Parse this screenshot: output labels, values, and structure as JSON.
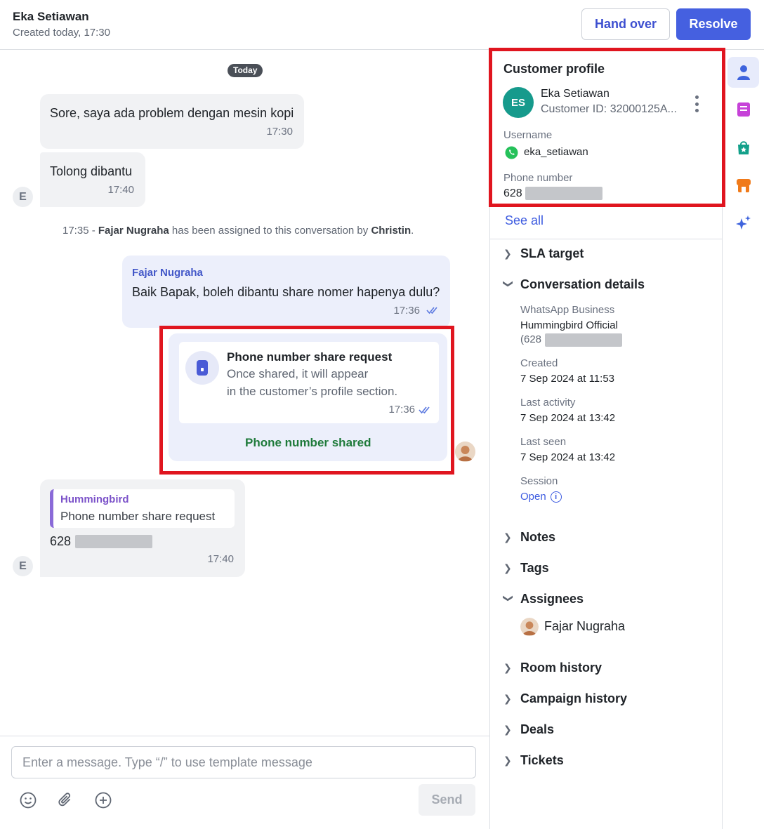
{
  "header": {
    "contact_name": "Eka Setiawan",
    "created": "Created today, 17:30",
    "hand_over_label": "Hand over",
    "resolve_label": "Resolve"
  },
  "chat": {
    "date_chip": "Today",
    "messages": [
      {
        "text": "Sore, saya ada problem dengan mesin kopi",
        "time": "17:30"
      },
      {
        "text": "Tolong dibantu",
        "time": "17:40"
      }
    ],
    "avatar_initial": "E",
    "system_message": {
      "time": "17:35 -",
      "agent": "Fajar Nugraha",
      "middle": "has been assigned to this conversation by",
      "by": "Christin",
      "end": "."
    },
    "agent_message": {
      "sender": "Fajar Nugraha",
      "text": "Baik Bapak, boleh dibantu share nomer hapenya dulu?",
      "time": "17:36"
    },
    "share_request": {
      "title": "Phone number share request",
      "line1": "Once shared, it will appear",
      "line2": "in the customer’s profile section.",
      "time": "17:36",
      "status": "Phone number shared"
    },
    "reply": {
      "quote_sender": "Hummingbird",
      "quote_text": "Phone number share request",
      "phone_prefix": "628",
      "time": "17:40"
    },
    "composer": {
      "placeholder": "Enter a message. Type “/” to use template message",
      "send_label": "Send"
    }
  },
  "profile": {
    "title": "Customer profile",
    "initials": "ES",
    "name": "Eka Setiawan",
    "customer_id": "Customer ID: 32000125A...",
    "username_label": "Username",
    "username": "eka_setiawan",
    "phone_label": "Phone number",
    "phone_prefix": "628",
    "see_all": "See all"
  },
  "sections": {
    "sla": "SLA target",
    "conversation_details": "Conversation details",
    "notes": "Notes",
    "tags": "Tags",
    "assignees": "Assignees",
    "room_history": "Room history",
    "campaign_history": "Campaign history",
    "deals": "Deals",
    "tickets": "Tickets"
  },
  "details": {
    "channel_label": "WhatsApp Business",
    "channel_name": "Hummingbird Official",
    "channel_phone_prefix": "(628",
    "created_label": "Created",
    "created_value": "7 Sep 2024 at 11:53",
    "last_activity_label": "Last activity",
    "last_activity_value": "7 Sep 2024 at 13:42",
    "last_seen_label": "Last seen",
    "last_seen_value": "7 Sep 2024 at 13:42",
    "session_label": "Session",
    "session_value": "Open",
    "info_glyph": "i"
  },
  "assignee": {
    "name": "Fajar Nugraha"
  },
  "colors": {
    "primary": "#4560e0",
    "highlight_border": "#e0151f",
    "shared_green": "#1e7a3a",
    "avatar_teal": "#169a8c"
  }
}
